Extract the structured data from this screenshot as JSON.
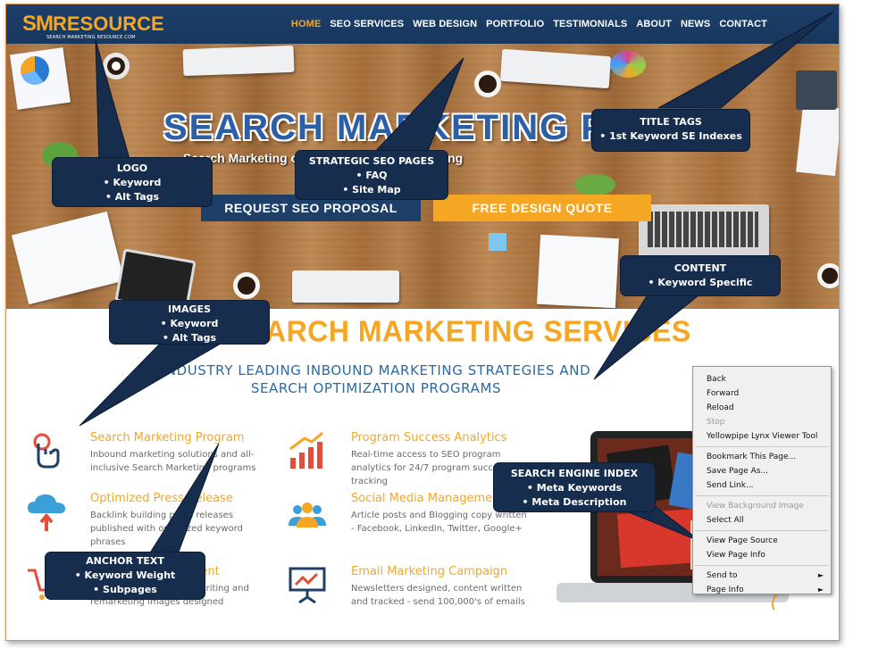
{
  "site": {
    "logo_sm": "SM",
    "logo_resource": "RESOURCE",
    "logo_tagline": "SEARCH MARKETING RESOURCE.COM"
  },
  "nav": {
    "items": [
      {
        "label": "HOME",
        "active": true
      },
      {
        "label": "SEO SERVICES",
        "active": false
      },
      {
        "label": "WEB DESIGN",
        "active": false
      },
      {
        "label": "PORTFOLIO",
        "active": false
      },
      {
        "label": "TESTIMONIALS",
        "active": false
      },
      {
        "label": "ABOUT",
        "active": false
      },
      {
        "label": "NEWS",
        "active": false
      },
      {
        "label": "CONTACT",
        "active": false
      }
    ]
  },
  "hero": {
    "title": "SEARCH MARKETING PROGR",
    "subtitle": "Search Marketing                    ocial Media - Content Writing",
    "btn_seo": "REQUEST SEO PROPOSAL",
    "btn_quote": "FREE DESIGN QUOTE"
  },
  "services": {
    "title": "ARCH MARKETING SERVICES",
    "sub1": "INDUSTRY LEADING INBOUND MARKETING STRATEGIES AND",
    "sub2": "SEARCH OPTIMIZATION PROGRAMS",
    "items": [
      {
        "title": "Search Marketing Program",
        "desc": "Inbound marketing solutions and all-inclusive Search Marketing programs",
        "icon": "touch-hand-icon"
      },
      {
        "title": "Program Success Analytics",
        "desc": "Real-time access to SEO program analytics for 24/7 program success tracking",
        "icon": "bar-chart-icon"
      },
      {
        "title": "Optimized Press Release",
        "desc": "Backlink building press releases published with optimized keyword phrases",
        "icon": "cloud-upload-icon"
      },
      {
        "title": "Social Media Management",
        "desc": "Article posts and Blogging copy written - Facebook, LinkedIn, Twitter, Google+",
        "icon": "people-icon"
      },
      {
        "title": "Paid Ads Management",
        "desc": "Paid ads campaigns, ad writing and remarketing images designed",
        "icon": "cart-icon"
      },
      {
        "title": "Email Marketing Campaign",
        "desc": "Newsletters designed, content written and tracked - send 100,000's of emails",
        "icon": "presentation-board-icon"
      }
    ]
  },
  "callouts": {
    "logo": [
      "LOGO",
      "• Keyword",
      "• Alt Tags"
    ],
    "strategic": [
      "STRATEGIC SEO PAGES",
      "• FAQ",
      "• Site Map"
    ],
    "title_tags": [
      "TITLE TAGS",
      "• 1st Keyword SE Indexes"
    ],
    "content": [
      "CONTENT",
      "• Keyword  Specific"
    ],
    "images": [
      "IMAGES",
      "• Keyword",
      "• Alt Tags"
    ],
    "se_index": [
      "SEARCH ENGINE INDEX",
      "• Meta Keywords",
      "• Meta Description"
    ],
    "anchor": [
      "ANCHOR TEXT",
      "• Keyword Weight",
      "• Subpages"
    ]
  },
  "context_menu": {
    "groups": [
      [
        {
          "label": "Back",
          "disabled": false
        },
        {
          "label": "Forward",
          "disabled": false
        },
        {
          "label": "Reload",
          "disabled": false
        },
        {
          "label": "Stop",
          "disabled": true
        },
        {
          "label": "Yellowpipe Lynx Viewer Tool",
          "disabled": false
        }
      ],
      [
        {
          "label": "Bookmark This Page...",
          "disabled": false
        },
        {
          "label": "Save Page As...",
          "disabled": false
        },
        {
          "label": "Send Link...",
          "disabled": false
        }
      ],
      [
        {
          "label": "View Background Image",
          "disabled": true
        },
        {
          "label": "Select All",
          "disabled": false
        }
      ],
      [
        {
          "label": "View Page Source",
          "disabled": false
        },
        {
          "label": "View Page Info",
          "disabled": false
        }
      ],
      [
        {
          "label": "Send to",
          "disabled": false,
          "submenu": true
        },
        {
          "label": "Page Info",
          "disabled": false,
          "submenu": true
        }
      ]
    ]
  },
  "colors": {
    "navy": "#1d3f68",
    "orange": "#f5a623",
    "blue_text": "#2b6aa3",
    "callout_bg": "#172d4e"
  }
}
